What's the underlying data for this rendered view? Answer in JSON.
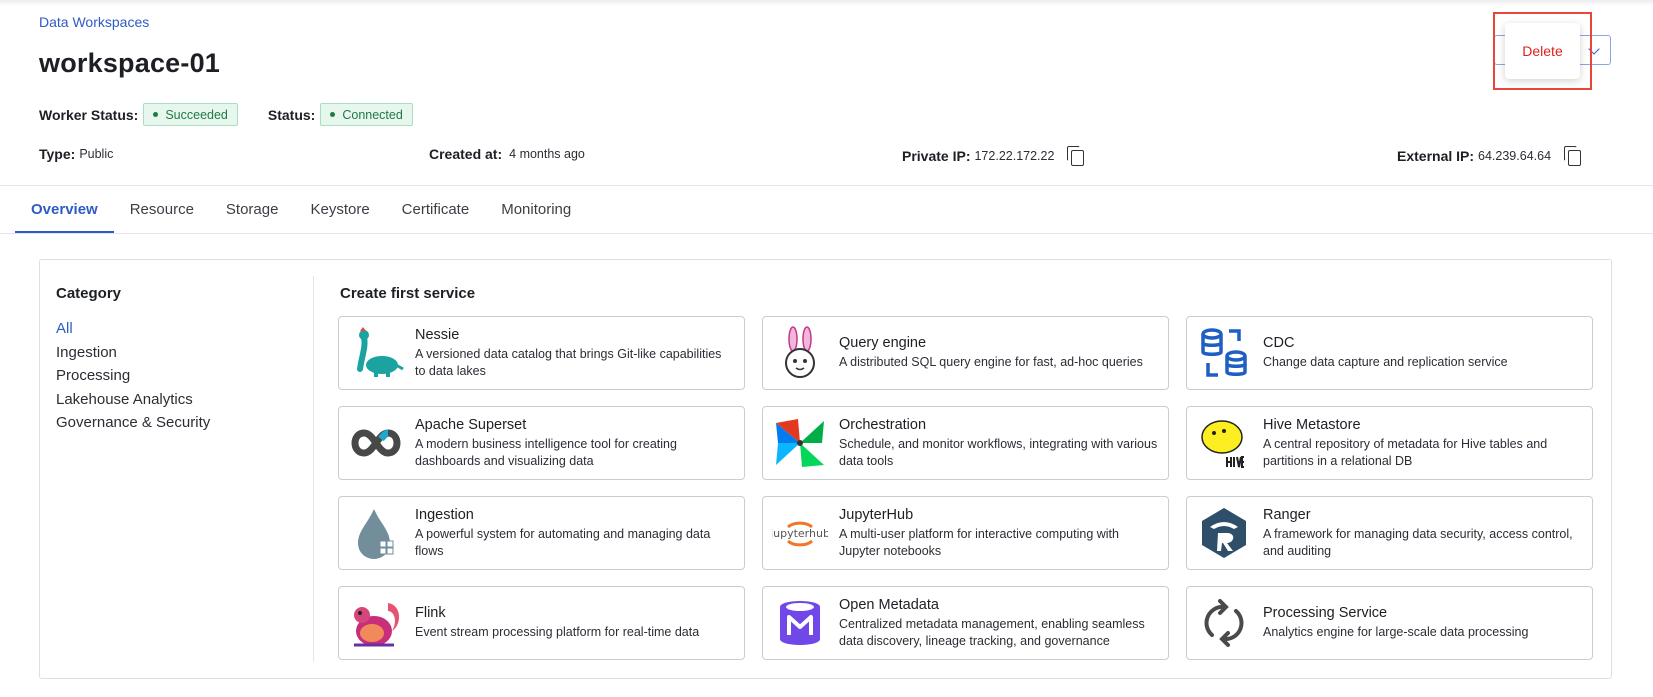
{
  "breadcrumb": "Data Workspaces",
  "title": "workspace-01",
  "worker_status": {
    "label": "Worker Status:",
    "value": "Succeeded"
  },
  "status": {
    "label": "Status:",
    "value": "Connected"
  },
  "info": {
    "type": {
      "label": "Type:",
      "value": "Public"
    },
    "created": {
      "label": "Created at:",
      "value": "4 months ago"
    },
    "private_ip": {
      "label": "Private IP:",
      "value": "172.22.172.22"
    },
    "external_ip": {
      "label": "External IP:",
      "value": "64.239.64.64"
    }
  },
  "actions": {
    "delete_label": "Delete"
  },
  "tabs": [
    {
      "label": "Overview",
      "active": true
    },
    {
      "label": "Resource"
    },
    {
      "label": "Storage"
    },
    {
      "label": "Keystore"
    },
    {
      "label": "Certificate"
    },
    {
      "label": "Monitoring"
    }
  ],
  "category": {
    "title": "Category",
    "items": [
      "All",
      "Ingestion",
      "Processing",
      "Lakehouse Analytics",
      "Governance & Security"
    ],
    "active": "All"
  },
  "services": {
    "title": "Create first service",
    "items": [
      {
        "name": "Nessie",
        "desc": "A versioned data catalog that brings Git-like capabilities to data lakes",
        "icon": "nessie-icon"
      },
      {
        "name": "Query engine",
        "desc": "A distributed SQL query engine for fast, ad-hoc queries",
        "icon": "query-engine-icon"
      },
      {
        "name": "CDC",
        "desc": "Change data capture and replication service",
        "icon": "cdc-icon"
      },
      {
        "name": "Apache Superset",
        "desc": "A modern business intelligence tool for creating dashboards and visualizing data",
        "icon": "superset-icon"
      },
      {
        "name": "Orchestration",
        "desc": "Schedule, and monitor workflows, integrating with various data tools",
        "icon": "orchestration-icon"
      },
      {
        "name": "Hive Metastore",
        "desc": "A central repository of metadata for Hive tables and partitions in a relational DB",
        "icon": "hive-icon"
      },
      {
        "name": "Ingestion",
        "desc": "A powerful system for automating and managing data flows",
        "icon": "ingestion-icon"
      },
      {
        "name": "JupyterHub",
        "desc": "A multi-user platform for interactive computing with Jupyter notebooks",
        "icon": "jupyterhub-icon"
      },
      {
        "name": "Ranger",
        "desc": "A framework for managing data security, access control, and auditing",
        "icon": "ranger-icon"
      },
      {
        "name": "Flink",
        "desc": "Event stream processing platform for real-time data",
        "icon": "flink-icon"
      },
      {
        "name": "Open Metadata",
        "desc": "Centralized metadata management, enabling seamless data discovery, lineage tracking, and governance",
        "icon": "open-metadata-icon"
      },
      {
        "name": "Processing Service",
        "desc": "Analytics engine for large-scale data processing",
        "icon": "processing-service-icon"
      }
    ]
  },
  "colors": {
    "accent": "#2f5bc4",
    "success_bg": "#e8f7ee",
    "success_text": "#1f7a45",
    "danger": "#e02020",
    "highlight": "#e8463a"
  }
}
